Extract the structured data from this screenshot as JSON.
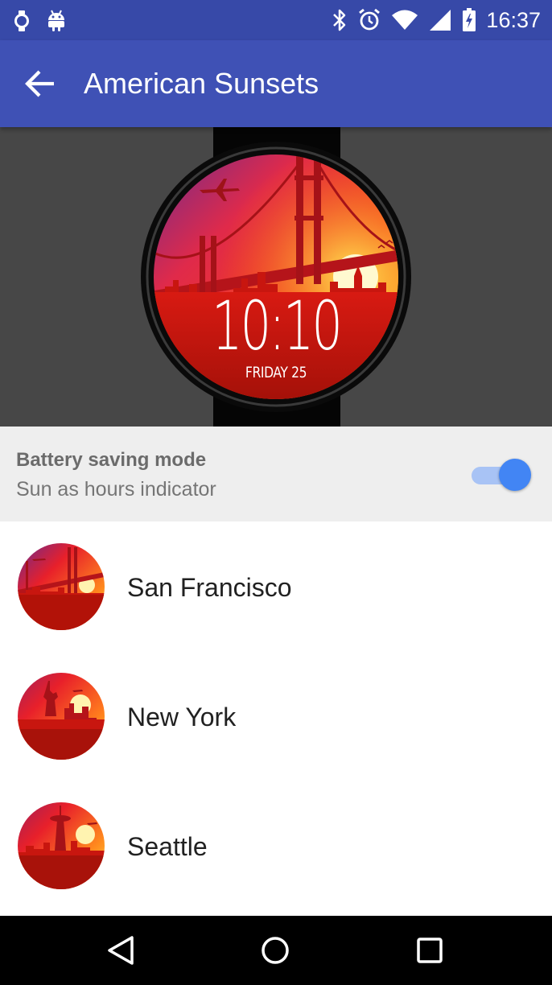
{
  "status_bar": {
    "time": "16:37",
    "left_icons": [
      "watch-icon",
      "android-icon"
    ],
    "right_icons": [
      "bluetooth-icon",
      "alarm-icon",
      "wifi-icon",
      "signal-icon",
      "battery-charging-icon"
    ]
  },
  "app_bar": {
    "back_icon": "arrow-back-icon",
    "title": "American Sunsets"
  },
  "preview": {
    "time": "10:10",
    "date": "FRIDAY 25"
  },
  "setting": {
    "title": "Battery saving mode",
    "summary": "Sun as hours indicator",
    "enabled": true
  },
  "cities": [
    {
      "name": "San Francisco",
      "thumbnail": "golden-gate-bridge"
    },
    {
      "name": "New York",
      "thumbnail": "statue-of-liberty"
    },
    {
      "name": "Seattle",
      "thumbnail": "space-needle"
    }
  ],
  "nav_bar": {
    "buttons": [
      "back-icon",
      "home-icon",
      "recents-icon"
    ]
  },
  "colors": {
    "status_bar": "#3749a8",
    "app_bar": "#3f51b5",
    "accent": "#4285f4",
    "sunset_top": "#6a2a8f",
    "sunset_mid": "#e8202a",
    "sunset_bottom": "#ffd21e"
  }
}
